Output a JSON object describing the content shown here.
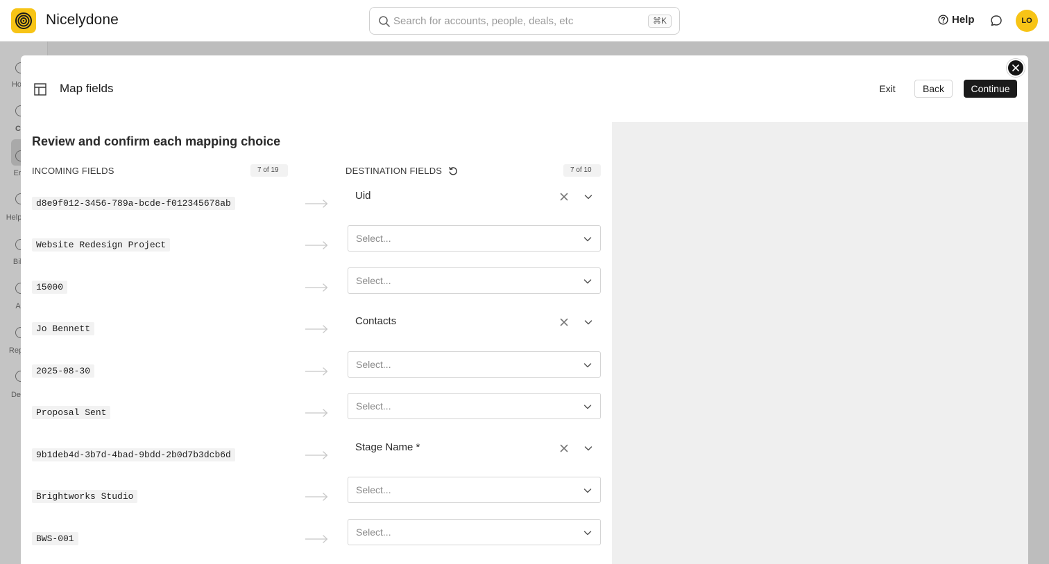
{
  "header": {
    "brand": "Nicelydone",
    "search_placeholder": "Search for accounts, people, deals, etc",
    "search_shortcut": "⌘K",
    "help_label": "Help",
    "avatar_initials": "LO",
    "accent_color": "#f7c416"
  },
  "background_sidebar": {
    "items": [
      "Ho",
      "C",
      "Er",
      "Help",
      "Bil",
      "A",
      "Rep",
      "De"
    ]
  },
  "modal": {
    "title": "Map fields",
    "exit_label": "Exit",
    "back_label": "Back",
    "continue_label": "Continue",
    "heading": "Review and confirm each mapping choice",
    "incoming_header": "INCOMING FIELDS",
    "incoming_count": "7 of 19",
    "destination_header": "DESTINATION FIELDS",
    "destination_count": "7 of 10",
    "select_placeholder": "Select...",
    "rows": [
      {
        "incoming": "d8e9f012-3456-789a-bcde-f012345678ab",
        "destination": "Uid"
      },
      {
        "incoming": "Website Redesign Project",
        "destination": ""
      },
      {
        "incoming": "15000",
        "destination": ""
      },
      {
        "incoming": "Jo Bennett",
        "destination": "Contacts"
      },
      {
        "incoming": "2025-08-30",
        "destination": ""
      },
      {
        "incoming": "Proposal Sent",
        "destination": ""
      },
      {
        "incoming": "9b1deb4d-3b7d-4bad-9bdd-2b0d7b3dcb6d",
        "destination": "Stage Name *"
      },
      {
        "incoming": "Brightworks Studio",
        "destination": ""
      },
      {
        "incoming": "BWS-001",
        "destination": ""
      }
    ]
  }
}
